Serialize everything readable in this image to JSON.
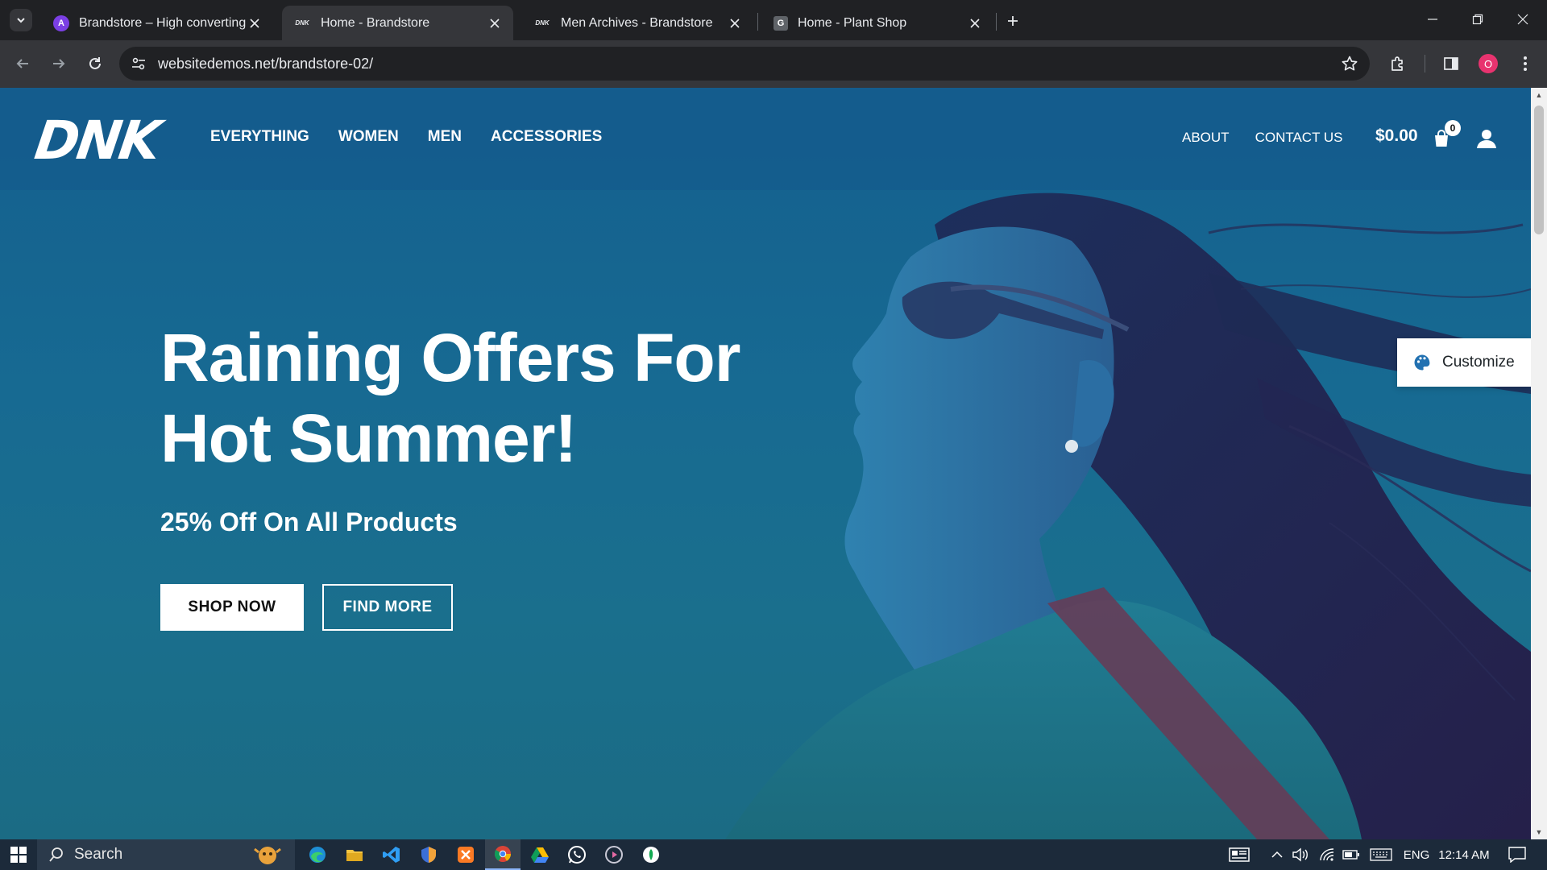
{
  "browser": {
    "tabs": [
      {
        "title": "Brandstore – High converting e",
        "active": false,
        "favicon": "astra-icon"
      },
      {
        "title": "Home - Brandstore",
        "active": true,
        "favicon": "dnk-icon"
      },
      {
        "title": "Men Archives - Brandstore",
        "active": false,
        "favicon": "dnk-icon"
      },
      {
        "title": "Home - Plant Shop",
        "active": false,
        "favicon": "g-icon"
      }
    ],
    "favicon_letters": {
      "astra": "A",
      "dnk": "DNK",
      "g": "G"
    },
    "url": "websitedemos.net/brandstore-02/",
    "profile_initial": "O"
  },
  "site": {
    "logo": "DNK",
    "nav": [
      "EVERYTHING",
      "WOMEN",
      "MEN",
      "ACCESSORIES"
    ],
    "secondary_nav": [
      "ABOUT",
      "CONTACT US"
    ],
    "cart_total": "$0.00",
    "cart_count": "0"
  },
  "hero": {
    "title_line1": "Raining Offers For",
    "title_line2": "Hot Summer!",
    "subtitle": "25% Off On All Products",
    "primary_button": "SHOP NOW",
    "secondary_button": "FIND MORE"
  },
  "customize": {
    "label": "Customize"
  },
  "taskbar": {
    "search_placeholder": "Search",
    "language": "ENG",
    "time": "12:14 AM"
  },
  "colors": {
    "hero_background": "#176a92",
    "chrome_dark": "#202124",
    "chrome_toolbar": "#35363a",
    "taskbar": "#1c2a3a",
    "profile_badge": "#e8336f"
  }
}
